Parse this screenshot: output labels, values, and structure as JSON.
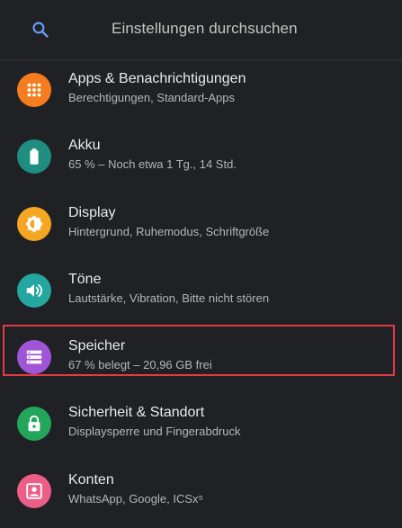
{
  "search": {
    "placeholder": "Einstellungen durchsuchen",
    "icon": "search-icon"
  },
  "settings": [
    {
      "title": "Apps & Benachrichtigungen",
      "subtitle": "Berechtigungen, Standard-Apps",
      "icon": "apps-grid-icon",
      "color": "#f57c1f"
    },
    {
      "title": "Akku",
      "subtitle": "65 % – Noch etwa 1 Tg., 14 Std.",
      "icon": "battery-icon",
      "color": "#1f8e80"
    },
    {
      "title": "Display",
      "subtitle": "Hintergrund, Ruhemodus, Schriftgröße",
      "icon": "brightness-icon",
      "color": "#f5a623"
    },
    {
      "title": "Töne",
      "subtitle": "Lautstärke, Vibration, Bitte nicht stören",
      "icon": "volume-icon",
      "color": "#23a7a0"
    },
    {
      "title": "Speicher",
      "subtitle": "67 % belegt – 20,96 GB frei",
      "icon": "storage-icon",
      "color": "#a055d6",
      "highlighted": true
    },
    {
      "title": "Sicherheit & Standort",
      "subtitle": "Displaysperre und Fingerabdruck",
      "icon": "lock-icon",
      "color": "#23a65b"
    },
    {
      "title": "Konten",
      "subtitle": "WhatsApp, Google, ICSx⁵",
      "icon": "account-icon",
      "color": "#ec5e88"
    }
  ],
  "highlight_color": "#e43a45"
}
